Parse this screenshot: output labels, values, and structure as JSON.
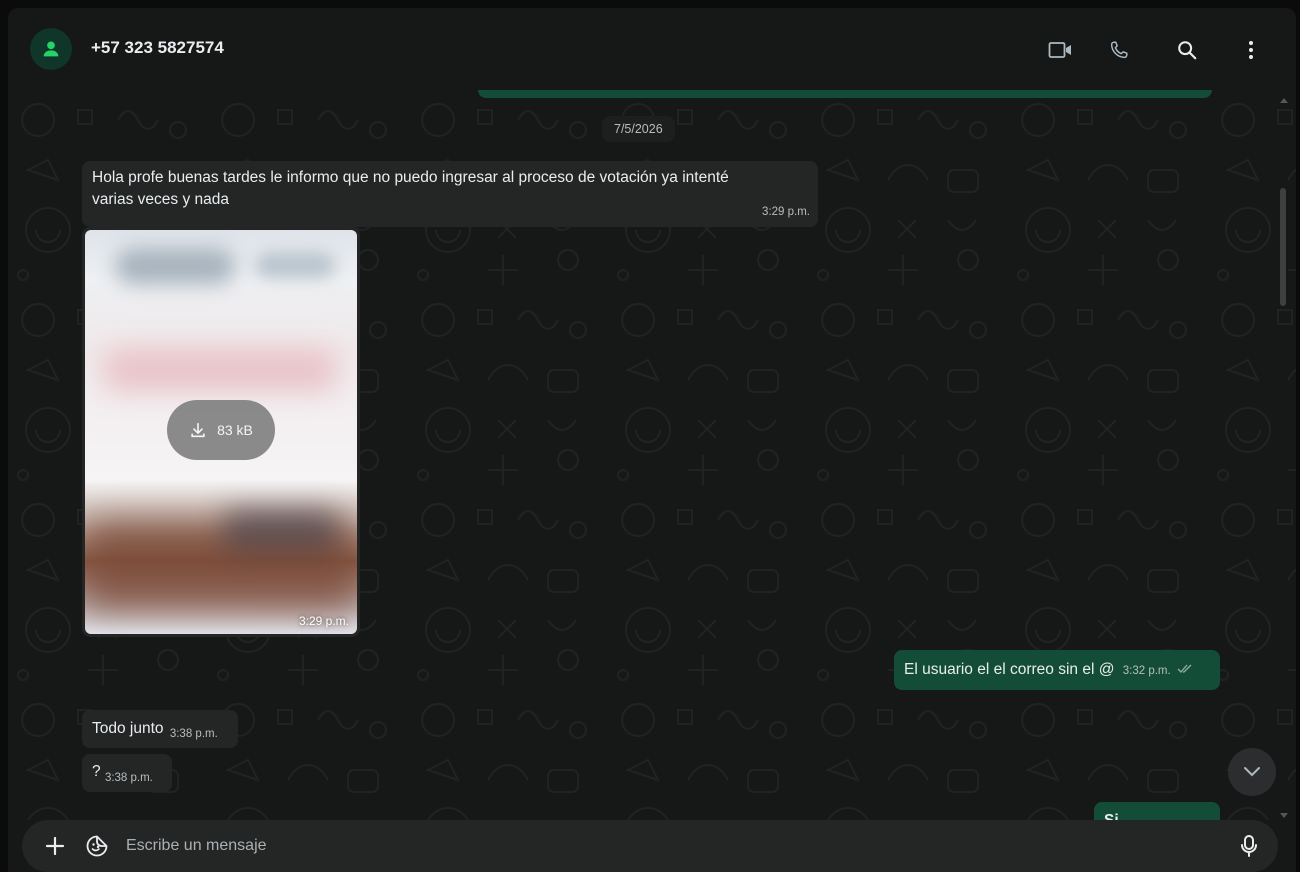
{
  "header": {
    "contact_name": "+57 323 5827574",
    "icons": [
      "video-call-icon",
      "voice-call-icon",
      "search-icon",
      "menu-icon"
    ]
  },
  "chat": {
    "date_chip": "7/5/2026",
    "messages": [
      {
        "direction": "in",
        "type": "text",
        "line1": "Hola profe buenas tardes le informo que no puedo ingresar al proceso de votación ya intenté",
        "line2": "varias veces y nada",
        "time": "3:29 p.m."
      },
      {
        "direction": "in",
        "type": "image",
        "download_size": "83 kB",
        "time": "3:29 p.m."
      },
      {
        "direction": "out",
        "type": "text",
        "text": "El usuario el el correo sin el @",
        "time": "3:32 p.m.",
        "status": "read-double-check"
      },
      {
        "direction": "in",
        "type": "text",
        "text": "Todo junto",
        "time": "3:38 p.m."
      },
      {
        "direction": "in",
        "type": "text",
        "text": "?",
        "time": "3:38 p.m."
      },
      {
        "direction": "out",
        "type": "text",
        "text": "Si",
        "partial": true
      }
    ]
  },
  "composer": {
    "placeholder": "Escribe un mensaje",
    "icons": [
      "plus-icon",
      "sticker-icon",
      "microphone-icon"
    ]
  },
  "colors": {
    "background": "#161717",
    "incoming_bubble": "#242626",
    "outgoing_bubble": "#144d37",
    "avatar_bg": "#103529",
    "accent": "#25d366"
  }
}
